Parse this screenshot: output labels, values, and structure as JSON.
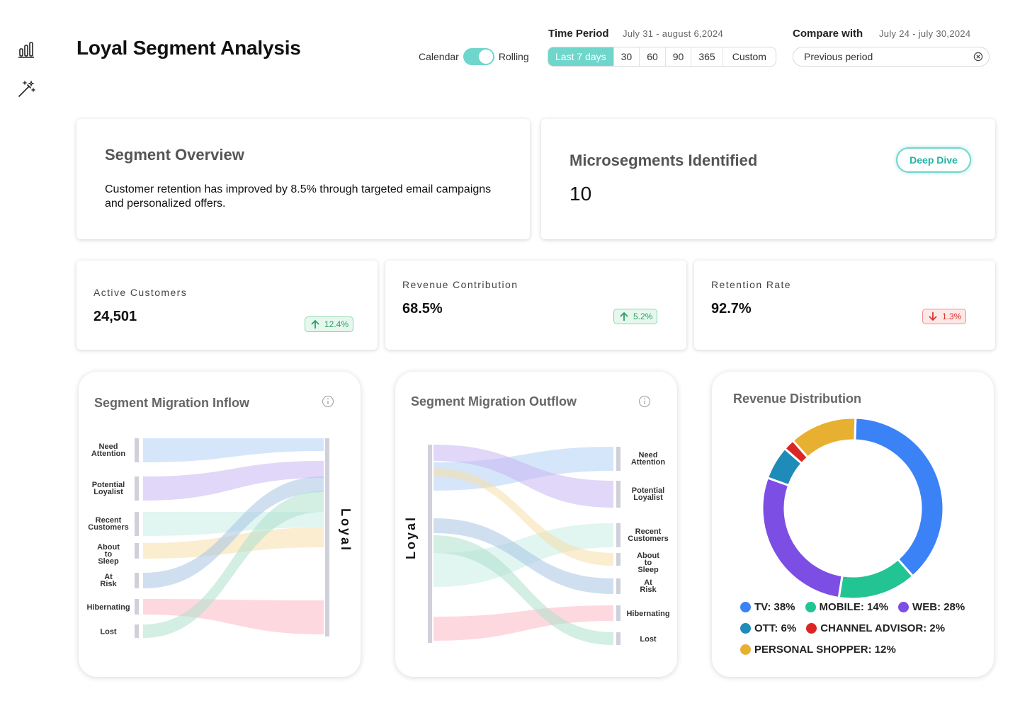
{
  "page": {
    "title": "Loyal Segment Analysis"
  },
  "toggle": {
    "left": "Calendar",
    "right": "Rolling",
    "state": "on"
  },
  "time_period": {
    "label": "Time Period",
    "range": "July 31 - august 6,2024",
    "options": [
      "Last 7 days",
      "30",
      "60",
      "90",
      "365",
      "Custom"
    ],
    "selected": "Last 7 days"
  },
  "compare": {
    "label": "Compare with",
    "range": "July 24 - july 30,2024",
    "value": "Previous period"
  },
  "overview": {
    "title": "Segment Overview",
    "text": "Customer retention has improved by 8.5% through targeted email campaigns and personalized offers."
  },
  "microsegments": {
    "title": "Microsegments Identified",
    "value": "10",
    "button": "Deep Dive"
  },
  "kpis": [
    {
      "label": "Active Customers",
      "value": "24,501",
      "change": "12.4%",
      "trend": "up"
    },
    {
      "label": "Revenue Contribution",
      "value": "68.5%",
      "change": "5.2%",
      "trend": "up"
    },
    {
      "label": "Retention Rate",
      "value": "92.7%",
      "change": "1.3%",
      "trend": "down"
    }
  ],
  "colors": {
    "accent": "#6fd6cc",
    "up": "#2f9e62",
    "down": "#d93434",
    "segments": {
      "Need Attention": "#b3d1f5",
      "Potential Loyalist": "#c8b6f2",
      "Recent Customers": "#c9ece6",
      "About to Sleep": "#f6deaa",
      "At Risk": "#a8c4e4",
      "Hibernating": "#fbb9c4",
      "Lost": "#aee0cc"
    }
  },
  "inflow": {
    "title": "Segment Migration Inflow",
    "target": "Loyal",
    "sources": [
      "Need Attention",
      "Potential Loyalist",
      "Recent Customers",
      "About to Sleep",
      "At Risk",
      "Hibernating",
      "Lost"
    ]
  },
  "outflow": {
    "title": "Segment Migration Outflow",
    "source": "Loyal",
    "targets": [
      "Need Attention",
      "Potential Loyalist",
      "Recent Customers",
      "About to Sleep",
      "At Risk",
      "Hibernating",
      "Lost"
    ]
  },
  "chart_data": {
    "type": "pie",
    "title": "Revenue Distribution",
    "slices": [
      {
        "name": "TV",
        "value": 38,
        "label": "TV: 38%",
        "color": "#3b82f6"
      },
      {
        "name": "MOBILE",
        "value": 14,
        "label": "MOBILE: 14%",
        "color": "#22c493"
      },
      {
        "name": "WEB",
        "value": 28,
        "label": "WEB: 28%",
        "color": "#7c4ee4"
      },
      {
        "name": "OTT",
        "value": 6,
        "label": "OTT: 6%",
        "color": "#1f8bb8"
      },
      {
        "name": "CHANNEL ADVISOR",
        "value": 2,
        "label": "CHANNEL ADVISOR: 2%",
        "color": "#dc2626"
      },
      {
        "name": "PERSONAL SHOPPER",
        "value": 12,
        "label": "PERSONAL SHOPPER: 12%",
        "color": "#e8b030"
      }
    ],
    "legend": "bottom"
  }
}
